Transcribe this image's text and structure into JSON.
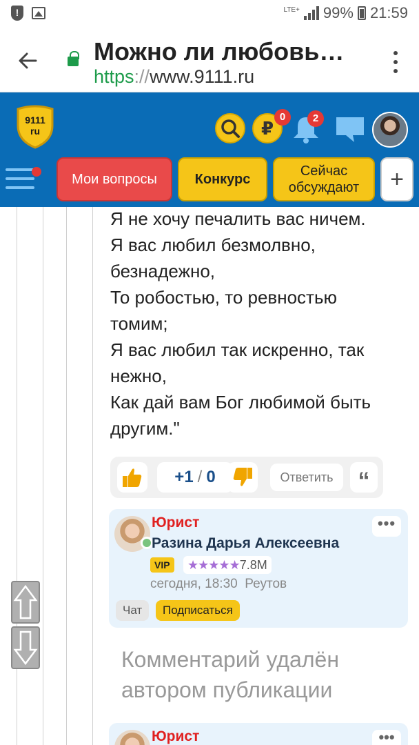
{
  "status_bar": {
    "network": "LTE+",
    "battery": "99%",
    "time": "21:59"
  },
  "browser": {
    "page_title": "Можно ли любовь…",
    "url_scheme": "https",
    "url_sep": "://",
    "url_host": "www.9111.ru"
  },
  "header": {
    "logo_line1": "9111",
    "logo_line2": "ru",
    "ruble_symbol": "₽",
    "ruble_badge": "0",
    "bell_badge": "2",
    "nav": {
      "my_questions": "Мои вопросы",
      "contest": "Конкурс",
      "discussing_line1": "Сейчас",
      "discussing_line2": "обсуждают",
      "plus": "+"
    }
  },
  "post": {
    "poem_lines": [
      "Я не хочу печалить вас ничем.",
      "Я вас любил безмолвно,",
      "безнадежно,",
      "То робостью, то ревностью",
      "томим;",
      "Я вас любил так искренно, так",
      "нежно,",
      "Как дай вам Бог любимой быть",
      "другим.\""
    ],
    "actions": {
      "plus_score": "+1",
      "separator": "/",
      "minus_score": "0",
      "reply": "Ответить",
      "quote": "“"
    }
  },
  "comment": {
    "role": "Юрист",
    "name": "Разина Дарья Алексеевна",
    "vip": "VIP",
    "stars": "★★★★★",
    "rating": "7.8M",
    "date": "сегодня, 18:30",
    "city": "Реутов",
    "chat": "Чат",
    "subscribe": "Подписаться",
    "more": "•••"
  },
  "deleted_comment": {
    "line1": "Комментарий удалён",
    "line2": "автором публикации"
  },
  "comment2": {
    "role": "Юрист",
    "more": "•••"
  },
  "colors": {
    "header_blue": "#0a6cb6",
    "accent_yellow": "#f5c518",
    "accent_red": "#e94a4a",
    "role_red": "#e02020"
  }
}
